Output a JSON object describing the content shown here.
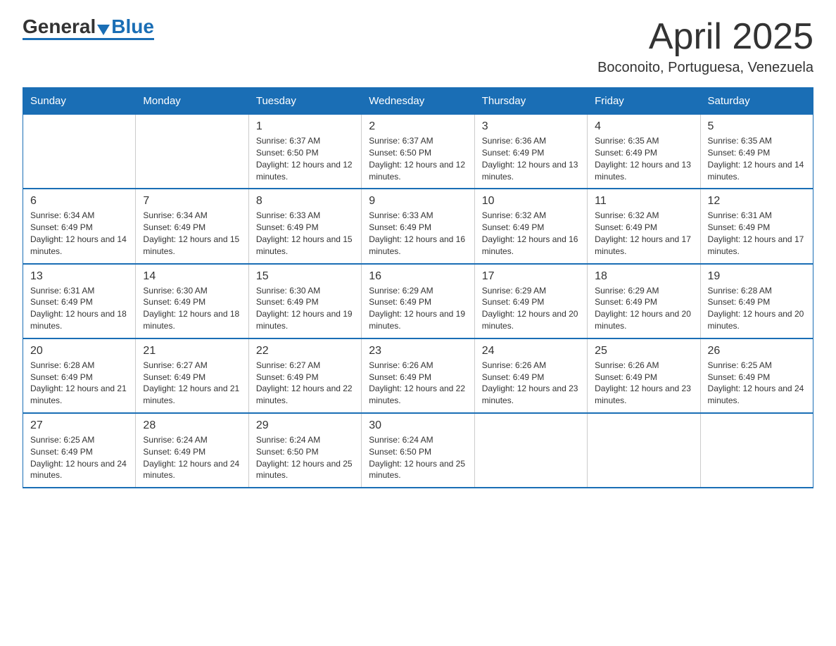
{
  "logo": {
    "general": "General",
    "blue": "Blue"
  },
  "title": "April 2025",
  "subtitle": "Boconoito, Portuguesa, Venezuela",
  "days_of_week": [
    "Sunday",
    "Monday",
    "Tuesday",
    "Wednesday",
    "Thursday",
    "Friday",
    "Saturday"
  ],
  "weeks": [
    [
      {
        "day": "",
        "sunrise": "",
        "sunset": "",
        "daylight": ""
      },
      {
        "day": "",
        "sunrise": "",
        "sunset": "",
        "daylight": ""
      },
      {
        "day": "1",
        "sunrise": "Sunrise: 6:37 AM",
        "sunset": "Sunset: 6:50 PM",
        "daylight": "Daylight: 12 hours and 12 minutes."
      },
      {
        "day": "2",
        "sunrise": "Sunrise: 6:37 AM",
        "sunset": "Sunset: 6:50 PM",
        "daylight": "Daylight: 12 hours and 12 minutes."
      },
      {
        "day": "3",
        "sunrise": "Sunrise: 6:36 AM",
        "sunset": "Sunset: 6:49 PM",
        "daylight": "Daylight: 12 hours and 13 minutes."
      },
      {
        "day": "4",
        "sunrise": "Sunrise: 6:35 AM",
        "sunset": "Sunset: 6:49 PM",
        "daylight": "Daylight: 12 hours and 13 minutes."
      },
      {
        "day": "5",
        "sunrise": "Sunrise: 6:35 AM",
        "sunset": "Sunset: 6:49 PM",
        "daylight": "Daylight: 12 hours and 14 minutes."
      }
    ],
    [
      {
        "day": "6",
        "sunrise": "Sunrise: 6:34 AM",
        "sunset": "Sunset: 6:49 PM",
        "daylight": "Daylight: 12 hours and 14 minutes."
      },
      {
        "day": "7",
        "sunrise": "Sunrise: 6:34 AM",
        "sunset": "Sunset: 6:49 PM",
        "daylight": "Daylight: 12 hours and 15 minutes."
      },
      {
        "day": "8",
        "sunrise": "Sunrise: 6:33 AM",
        "sunset": "Sunset: 6:49 PM",
        "daylight": "Daylight: 12 hours and 15 minutes."
      },
      {
        "day": "9",
        "sunrise": "Sunrise: 6:33 AM",
        "sunset": "Sunset: 6:49 PM",
        "daylight": "Daylight: 12 hours and 16 minutes."
      },
      {
        "day": "10",
        "sunrise": "Sunrise: 6:32 AM",
        "sunset": "Sunset: 6:49 PM",
        "daylight": "Daylight: 12 hours and 16 minutes."
      },
      {
        "day": "11",
        "sunrise": "Sunrise: 6:32 AM",
        "sunset": "Sunset: 6:49 PM",
        "daylight": "Daylight: 12 hours and 17 minutes."
      },
      {
        "day": "12",
        "sunrise": "Sunrise: 6:31 AM",
        "sunset": "Sunset: 6:49 PM",
        "daylight": "Daylight: 12 hours and 17 minutes."
      }
    ],
    [
      {
        "day": "13",
        "sunrise": "Sunrise: 6:31 AM",
        "sunset": "Sunset: 6:49 PM",
        "daylight": "Daylight: 12 hours and 18 minutes."
      },
      {
        "day": "14",
        "sunrise": "Sunrise: 6:30 AM",
        "sunset": "Sunset: 6:49 PM",
        "daylight": "Daylight: 12 hours and 18 minutes."
      },
      {
        "day": "15",
        "sunrise": "Sunrise: 6:30 AM",
        "sunset": "Sunset: 6:49 PM",
        "daylight": "Daylight: 12 hours and 19 minutes."
      },
      {
        "day": "16",
        "sunrise": "Sunrise: 6:29 AM",
        "sunset": "Sunset: 6:49 PM",
        "daylight": "Daylight: 12 hours and 19 minutes."
      },
      {
        "day": "17",
        "sunrise": "Sunrise: 6:29 AM",
        "sunset": "Sunset: 6:49 PM",
        "daylight": "Daylight: 12 hours and 20 minutes."
      },
      {
        "day": "18",
        "sunrise": "Sunrise: 6:29 AM",
        "sunset": "Sunset: 6:49 PM",
        "daylight": "Daylight: 12 hours and 20 minutes."
      },
      {
        "day": "19",
        "sunrise": "Sunrise: 6:28 AM",
        "sunset": "Sunset: 6:49 PM",
        "daylight": "Daylight: 12 hours and 20 minutes."
      }
    ],
    [
      {
        "day": "20",
        "sunrise": "Sunrise: 6:28 AM",
        "sunset": "Sunset: 6:49 PM",
        "daylight": "Daylight: 12 hours and 21 minutes."
      },
      {
        "day": "21",
        "sunrise": "Sunrise: 6:27 AM",
        "sunset": "Sunset: 6:49 PM",
        "daylight": "Daylight: 12 hours and 21 minutes."
      },
      {
        "day": "22",
        "sunrise": "Sunrise: 6:27 AM",
        "sunset": "Sunset: 6:49 PM",
        "daylight": "Daylight: 12 hours and 22 minutes."
      },
      {
        "day": "23",
        "sunrise": "Sunrise: 6:26 AM",
        "sunset": "Sunset: 6:49 PM",
        "daylight": "Daylight: 12 hours and 22 minutes."
      },
      {
        "day": "24",
        "sunrise": "Sunrise: 6:26 AM",
        "sunset": "Sunset: 6:49 PM",
        "daylight": "Daylight: 12 hours and 23 minutes."
      },
      {
        "day": "25",
        "sunrise": "Sunrise: 6:26 AM",
        "sunset": "Sunset: 6:49 PM",
        "daylight": "Daylight: 12 hours and 23 minutes."
      },
      {
        "day": "26",
        "sunrise": "Sunrise: 6:25 AM",
        "sunset": "Sunset: 6:49 PM",
        "daylight": "Daylight: 12 hours and 24 minutes."
      }
    ],
    [
      {
        "day": "27",
        "sunrise": "Sunrise: 6:25 AM",
        "sunset": "Sunset: 6:49 PM",
        "daylight": "Daylight: 12 hours and 24 minutes."
      },
      {
        "day": "28",
        "sunrise": "Sunrise: 6:24 AM",
        "sunset": "Sunset: 6:49 PM",
        "daylight": "Daylight: 12 hours and 24 minutes."
      },
      {
        "day": "29",
        "sunrise": "Sunrise: 6:24 AM",
        "sunset": "Sunset: 6:50 PM",
        "daylight": "Daylight: 12 hours and 25 minutes."
      },
      {
        "day": "30",
        "sunrise": "Sunrise: 6:24 AM",
        "sunset": "Sunset: 6:50 PM",
        "daylight": "Daylight: 12 hours and 25 minutes."
      },
      {
        "day": "",
        "sunrise": "",
        "sunset": "",
        "daylight": ""
      },
      {
        "day": "",
        "sunrise": "",
        "sunset": "",
        "daylight": ""
      },
      {
        "day": "",
        "sunrise": "",
        "sunset": "",
        "daylight": ""
      }
    ]
  ],
  "accent_color": "#1a6eb5"
}
